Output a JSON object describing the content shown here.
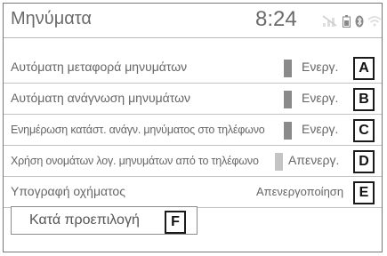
{
  "header": {
    "title": "Μηνύματα",
    "time": "8:24",
    "status_icons": [
      "signal-off-icon",
      "battery-icon",
      "bluetooth-icon",
      "wifi-icon"
    ]
  },
  "rows": [
    {
      "label": "Αυτόματη μεταφορά μηνυμάτων",
      "value": "Ενεργ.",
      "state": "on",
      "callout": "A"
    },
    {
      "label": "Αυτόματη ανάγνωση μηνυμάτων",
      "value": "Ενεργ.",
      "state": "on",
      "callout": "B"
    },
    {
      "label": "Ενημέρωση κατάστ. ανάγν. μηνύματος στο τηλέφωνο",
      "value": "Ενεργ.",
      "state": "on",
      "callout": "C"
    },
    {
      "label": "Χρήση ονομάτων λογ. μηνυμάτων από το τηλέφωνο",
      "value": "Απενεργ.",
      "state": "off",
      "callout": "D"
    },
    {
      "label": "Υπογραφή οχήματος",
      "value": "Απενεργοποίηση",
      "state": "none",
      "callout": "E"
    }
  ],
  "default_button": {
    "label": "Κατά προεπιλογή",
    "callout": "F"
  },
  "colors": {
    "text": "#666666",
    "indicator_on": "#8a8a8a",
    "indicator_off": "#c4c4c4"
  }
}
